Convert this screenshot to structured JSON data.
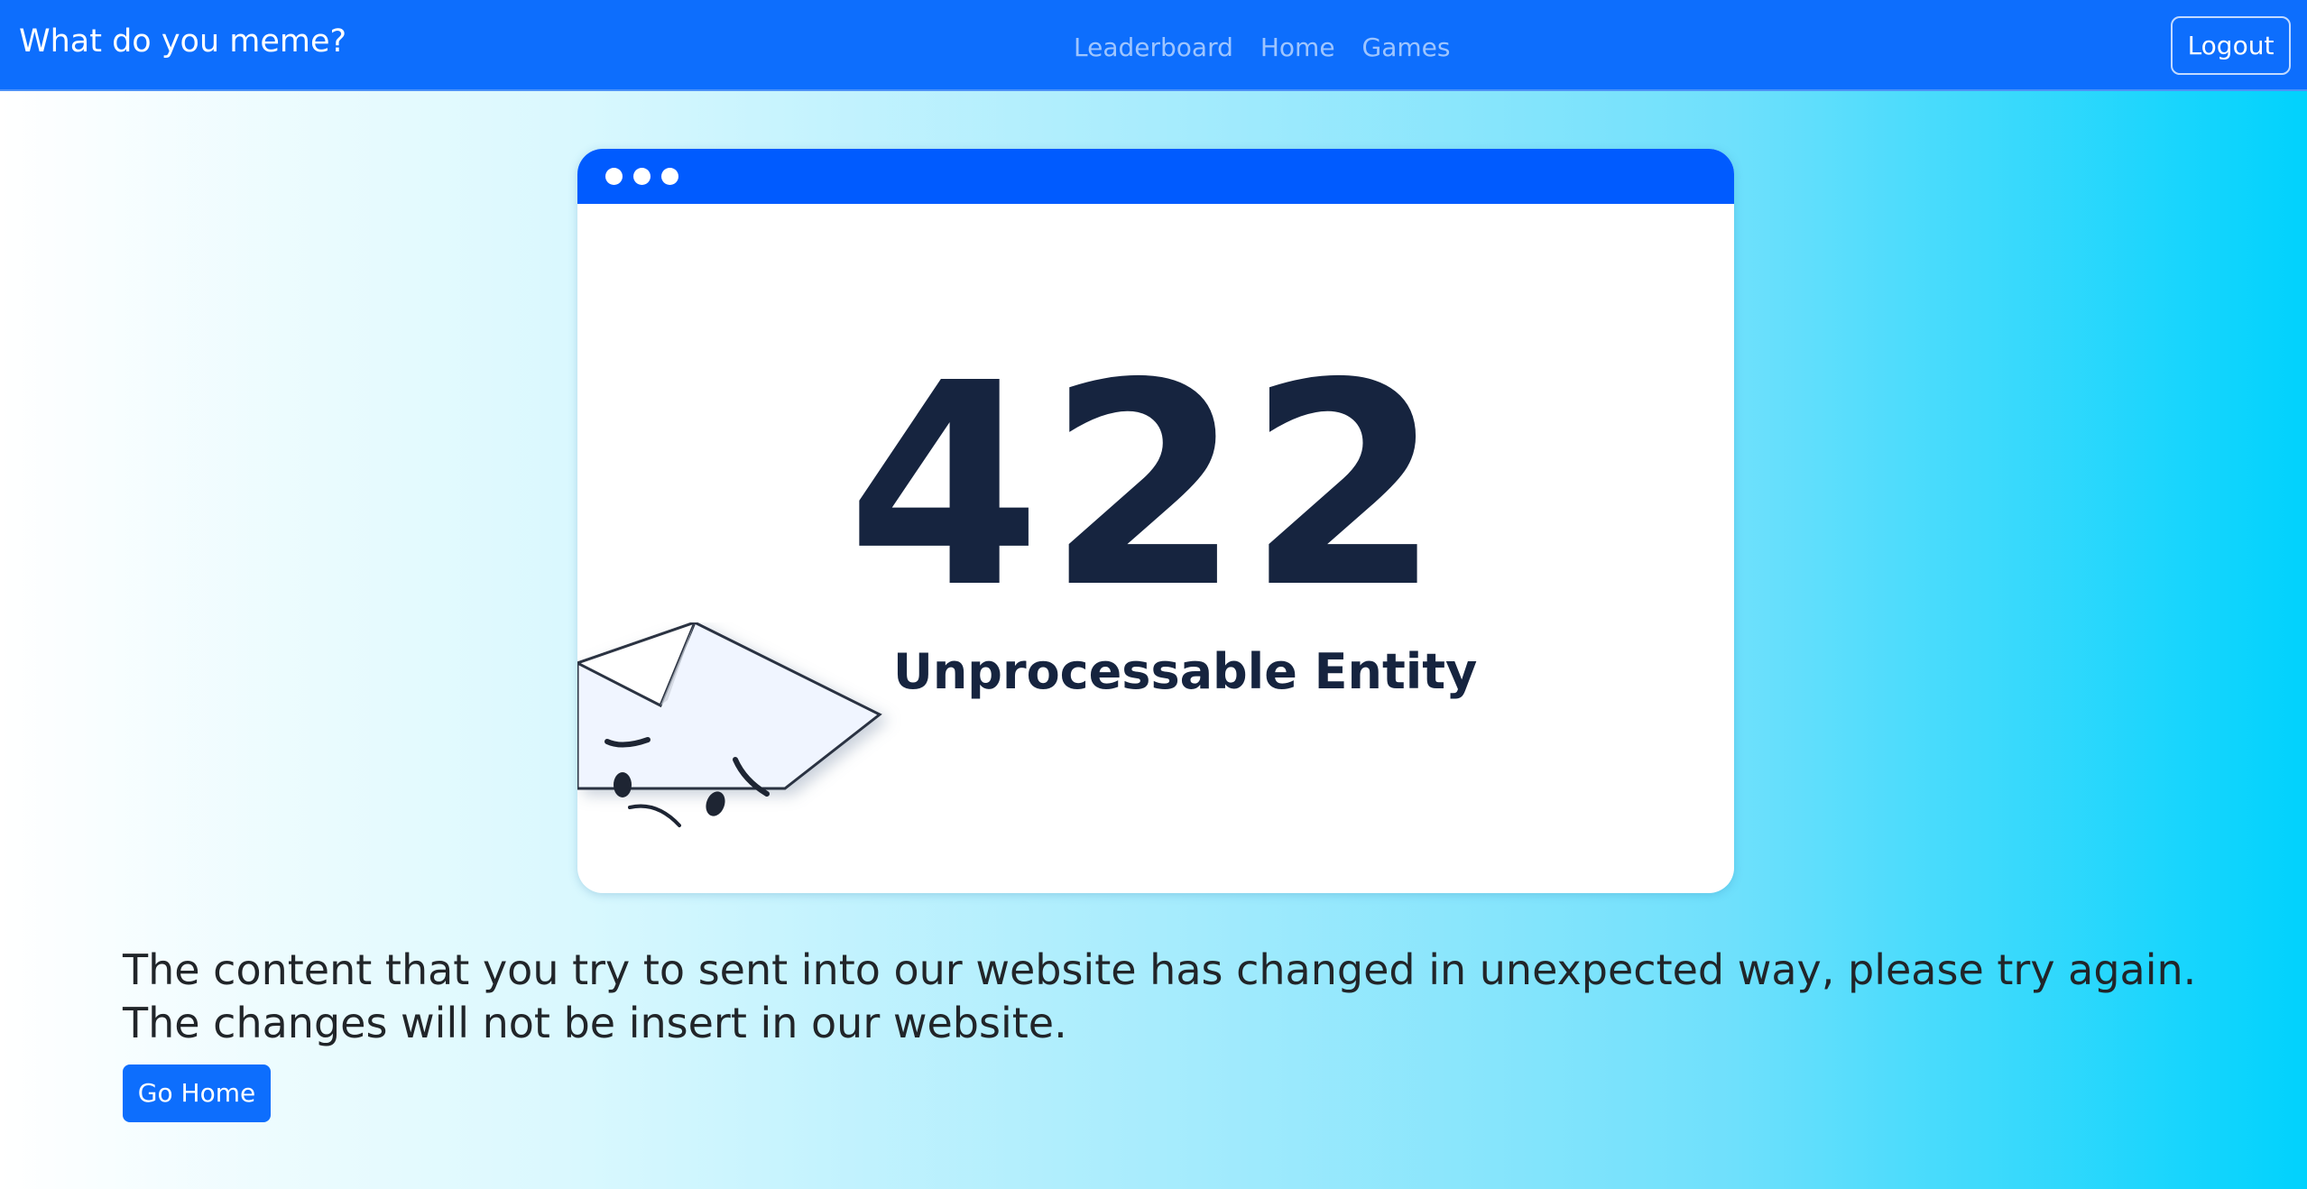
{
  "navbar": {
    "brand": "What do you meme?",
    "links": [
      {
        "label": "Leaderboard"
      },
      {
        "label": "Home"
      },
      {
        "label": "Games"
      }
    ],
    "logout_label": "Logout"
  },
  "illustration": {
    "code": "422",
    "title": "Unprocessable Entity"
  },
  "main": {
    "message": "The content that you try to sent into our website has changed in unexpected way, please try again. The changes will not be insert in our website.",
    "go_home_label": "Go Home"
  },
  "colors": {
    "navbar": "#0d6efd",
    "button": "#0d6efd",
    "illustration_bar": "#005bff",
    "error_text": "#16243f"
  }
}
